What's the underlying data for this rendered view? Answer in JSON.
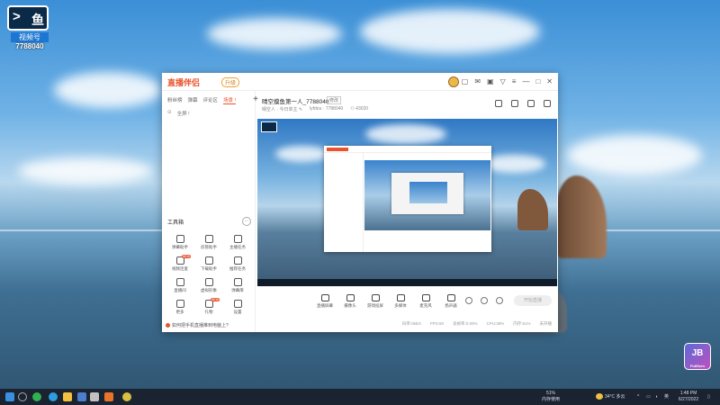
{
  "desktop": {
    "logo_tag": "视频号",
    "logo_id": "7788040",
    "corner_badge": "JB",
    "corner_badge_small": "FullScrn"
  },
  "app": {
    "brand": "直播伴侣",
    "brand_pill": "升级",
    "sidebar": {
      "tabs": [
        "粉丝榜",
        "弹幕",
        "评论区",
        "场景 !"
      ],
      "sub": [
        "⊙",
        "全屏 !"
      ],
      "tools_title": "工具箱",
      "tools": [
        {
          "label": "弹幕助手",
          "badge": ""
        },
        {
          "label": "房管助手",
          "badge": ""
        },
        {
          "label": "主播任务",
          "badge": ""
        },
        {
          "label": "视频连麦",
          "badge": "NEW"
        },
        {
          "label": "下载助手",
          "badge": ""
        },
        {
          "label": "推荐任务",
          "badge": ""
        },
        {
          "label": "直播间",
          "badge": ""
        },
        {
          "label": "虚拟形象",
          "badge": ""
        },
        {
          "label": "弹幕库",
          "badge": ""
        },
        {
          "label": "更多",
          "badge": ""
        },
        {
          "label": "礼物",
          "badge": "NEW"
        },
        {
          "label": "设置",
          "badge": ""
        }
      ],
      "footer": "如何把手机直播推到电脑上?"
    },
    "room": {
      "title": "晴空摸鱼第一人_7788040",
      "tag": "修改",
      "meta": [
        "晴空人 · 今日单主 ✎",
        "lyfdou · 7788040",
        "⚇ 43020"
      ]
    },
    "controls": [
      {
        "label": "直播屏幕"
      },
      {
        "label": "摄像头"
      },
      {
        "label": "游戏投屏"
      },
      {
        "label": "多媒体"
      },
      {
        "label": "麦克风"
      },
      {
        "label": "扬声器"
      }
    ],
    "start_label": "开始直播",
    "status": [
      "码率:0kb/s",
      "FPS:60",
      "丢帧率:0.00%",
      "CPU:38%",
      "内存:51%",
      "未开播"
    ]
  },
  "taskbar": {
    "tray_percent": "51%",
    "tray_label": "内存使用",
    "weather": "34°C 多云",
    "time": "1:48 PM",
    "date": "6/27/2022"
  }
}
